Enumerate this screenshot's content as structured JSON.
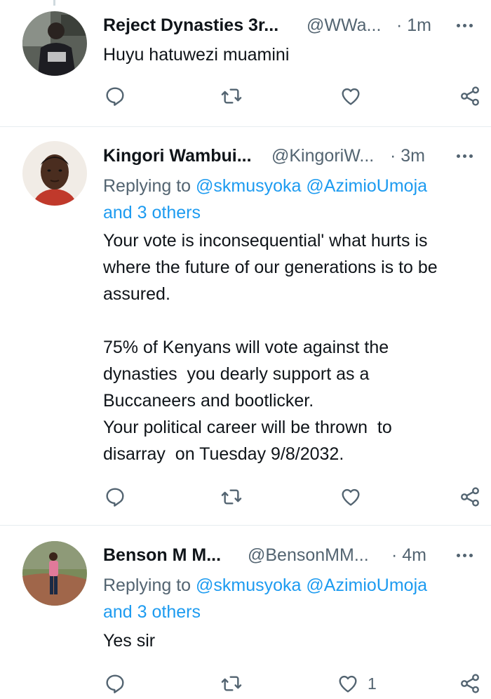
{
  "tweets": [
    {
      "name": "Reject Dynasties 3r...",
      "handle": "@WWa...",
      "time": "· 1m",
      "replying": null,
      "text": "Huyu hatuwezi muamini",
      "likes": ""
    },
    {
      "name": "Kingori Wambui...",
      "handle": "@KingoriW...",
      "time": "· 3m",
      "replying": {
        "prefix": "Replying to",
        "mentions": "@skmusyoka @AzimioUmoja",
        "others": "and 3 others"
      },
      "text": "Your vote is inconsequential' what hurts is\nwhere the future of our generations is to be\nassured.\n\n75% of Kenyans will vote against the\ndynasties  you dearly support as a\nBuccaneers and bootlicker.\nYour political career will be thrown  to\ndisarray  on Tuesday 9/8/2032.",
      "likes": ""
    },
    {
      "name": "Benson M M...",
      "handle": "@BensonMM...",
      "time": "· 4m",
      "replying": {
        "prefix": "Replying to",
        "mentions": "@skmusyoka @AzimioUmoja",
        "others": "and 3 others"
      },
      "text": "Yes sir",
      "likes": "1"
    }
  ],
  "icons": {
    "reply": "reply-icon",
    "retweet": "retweet-icon",
    "like": "heart-icon",
    "share": "share-icon",
    "more": "more-icon"
  },
  "colors": {
    "text": "#0f1419",
    "muted": "#536471",
    "link": "#1d9bf0",
    "divider": "#e6ecf0"
  }
}
